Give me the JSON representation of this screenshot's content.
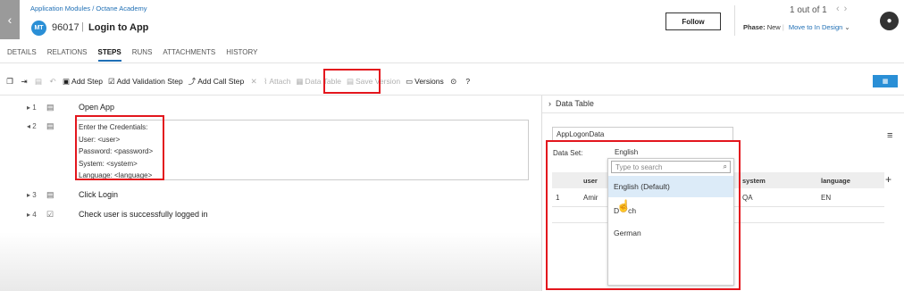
{
  "header": {
    "back_glyph": "‹",
    "breadcrumb": "Application Modules / Octane Academy",
    "badge": "MT",
    "entity_id": "96017",
    "separator": "|",
    "entity_name": "Login to App",
    "follow_label": "Follow",
    "pager": "1 out of 1",
    "pager_prev": "‹",
    "pager_next": "›",
    "phase_label": "Phase:",
    "phase_value": "New",
    "phase_sep": "|",
    "phase_action": "Move to In Design",
    "phase_chevron": "⌄",
    "chat_glyph": "💬"
  },
  "tabs": [
    {
      "label": "DETAILS"
    },
    {
      "label": "RELATIONS"
    },
    {
      "label": "STEPS"
    },
    {
      "label": "RUNS"
    },
    {
      "label": "ATTACHMENTS"
    },
    {
      "label": "HISTORY"
    }
  ],
  "toolbar": {
    "add_step": "Add Step",
    "add_validation_step": "Add Validation Step",
    "add_call_step": "Add Call Step",
    "attach": "Attach",
    "data_table": "Data Table",
    "save_version": "Save Version",
    "versions": "Versions",
    "view_toggle_glyph": "▦"
  },
  "steps": [
    {
      "num": "1",
      "text": "Open App"
    },
    {
      "num": "2",
      "lines": [
        "Enter the Credentials:",
        "User: <user>",
        "Password: <password>",
        "System: <system>",
        "Language: <language>"
      ]
    },
    {
      "num": "3",
      "text": "Click Login"
    },
    {
      "num": "4",
      "text": "Check user is successfully logged in"
    }
  ],
  "data_table_panel": {
    "title": "Data Table",
    "table_name": "AppLogonData",
    "dataset_label": "Data Set:",
    "dataset_value": "English",
    "columns": [
      "user",
      "system",
      "language"
    ],
    "rows": [
      {
        "index": "1",
        "user": "Amir",
        "system": "QA",
        "language": "EN"
      }
    ],
    "add_glyph": "+"
  },
  "dropdown": {
    "placeholder": "Type to search",
    "options": [
      "English (Default)",
      "Dutch",
      "German"
    ],
    "selected_index": 0,
    "visible_text_partial": [
      "D",
      "ch"
    ]
  },
  "colors": {
    "accent": "#1f6fb5",
    "highlight": "#e3161d",
    "badge": "#2a8fd6"
  }
}
